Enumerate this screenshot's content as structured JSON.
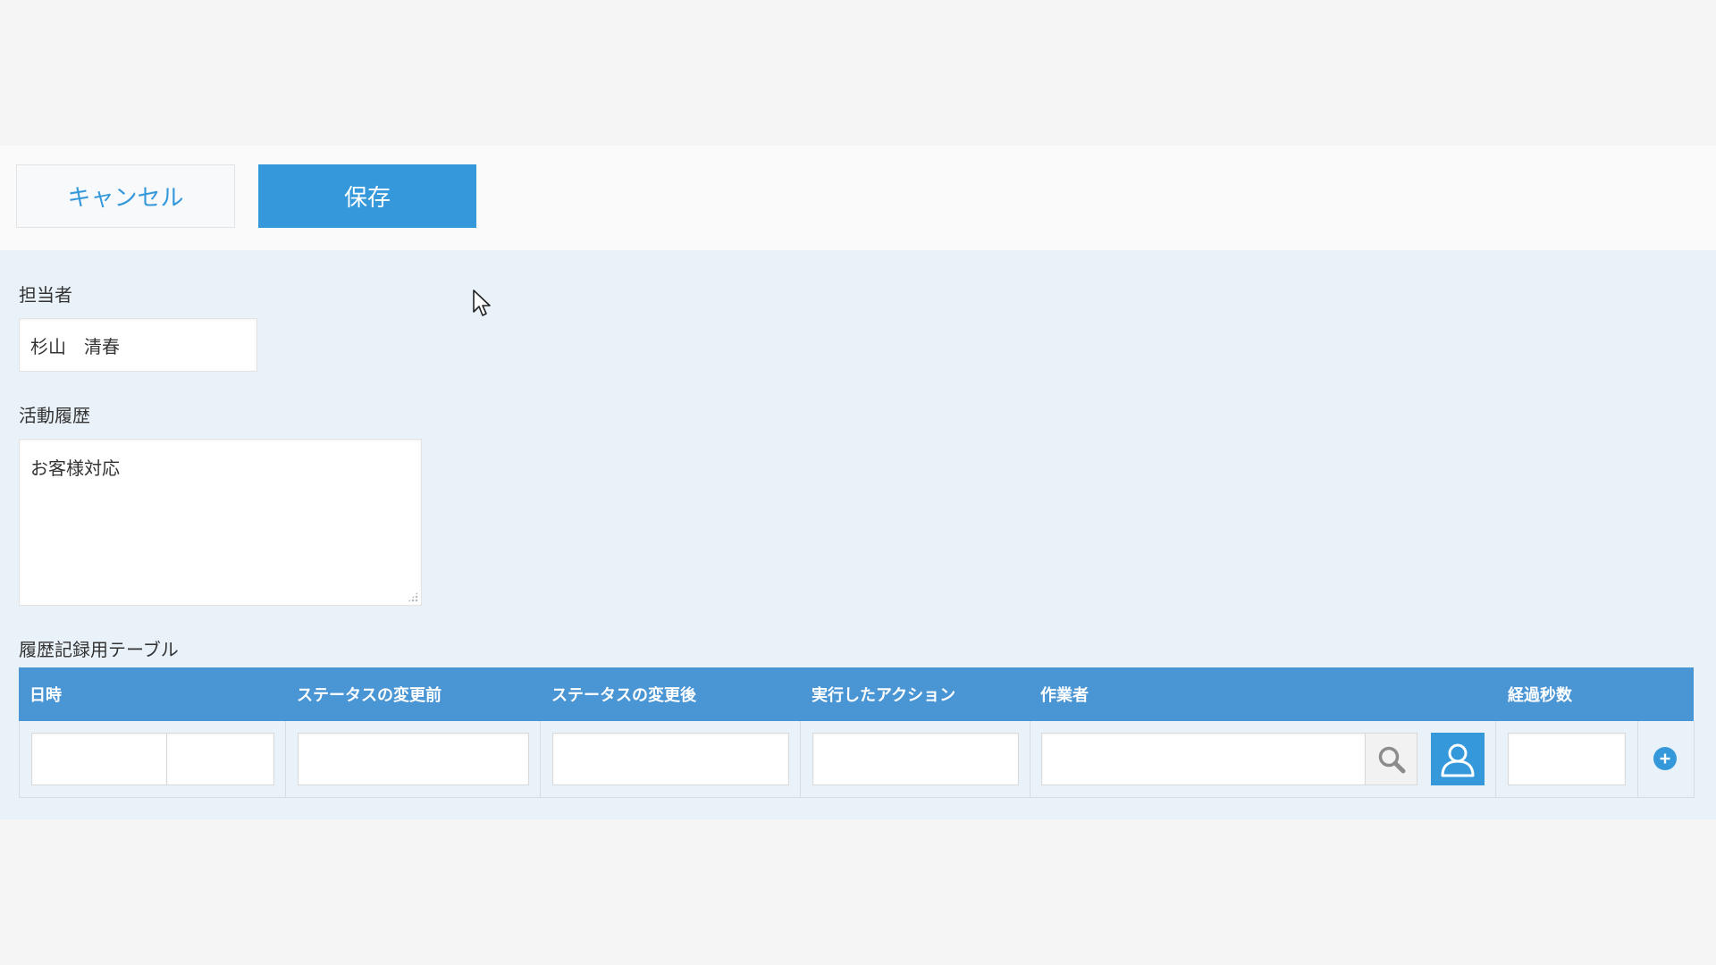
{
  "toolbar": {
    "cancel_label": "キャンセル",
    "save_label": "保存"
  },
  "fields": {
    "assignee": {
      "label": "担当者",
      "value": "杉山　清春"
    },
    "activity": {
      "label": "活動履歴",
      "value": "お客様対応"
    }
  },
  "table": {
    "label": "履歴記録用テーブル",
    "columns": [
      "日時",
      "ステータスの変更前",
      "ステータスの変更後",
      "実行したアクション",
      "作業者",
      "経過秒数"
    ]
  },
  "icons": {
    "search": "search-icon",
    "user": "user-icon",
    "add_row": "plus-circle-icon",
    "cursor": "mouse-pointer-icon"
  },
  "colors": {
    "accent": "#3498db",
    "table_header": "#4a95d4",
    "form_background": "#e9f2f9",
    "page_background": "#f5f5f5"
  }
}
